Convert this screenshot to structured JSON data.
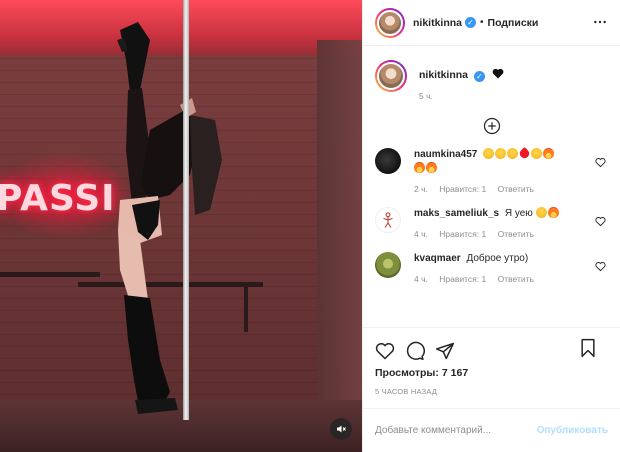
{
  "header": {
    "username": "nikitkinna",
    "separator": "•",
    "follow_label": "Подписки",
    "more_icon": "more-horizontal-icon"
  },
  "media": {
    "neon_text": "PASSI",
    "mute_icon": "sound-off-icon"
  },
  "caption": {
    "username": "nikitkinna",
    "emoji": "black-heart",
    "time": "5 ч."
  },
  "load_more_icon": "plus-circle-icon",
  "comments": [
    {
      "username": "naumkina457",
      "text": "",
      "emoji": [
        "face",
        "face",
        "face",
        "heart",
        "face",
        "fire",
        "fire",
        "fire"
      ],
      "time": "2 ч.",
      "likes": "Нравится: 1",
      "reply": "Ответить"
    },
    {
      "username": "maks_sameliuk_s",
      "text": "Я уею",
      "emoji": [
        "face",
        "fire"
      ],
      "time": "4 ч.",
      "likes": "Нравится: 1",
      "reply": "Ответить"
    },
    {
      "username": "kvaqmaer",
      "text": "Доброе утро)",
      "emoji": [],
      "time": "4 ч.",
      "likes": "Нравится: 1",
      "reply": "Ответить"
    }
  ],
  "actions": {
    "like_icon": "heart-icon",
    "comment_icon": "comment-icon",
    "share_icon": "send-icon",
    "save_icon": "bookmark-icon"
  },
  "views": {
    "label": "Просмотры:",
    "count": "7 167"
  },
  "post_time": "5 ЧАСОВ НАЗАД",
  "add_comment": {
    "placeholder": "Добавьте комментарий...",
    "publish_label": "Опубликовать"
  },
  "colors": {
    "verified": "#3897f0",
    "publish_disabled": "#b2dffc",
    "muted_text": "#8e8e8e"
  }
}
